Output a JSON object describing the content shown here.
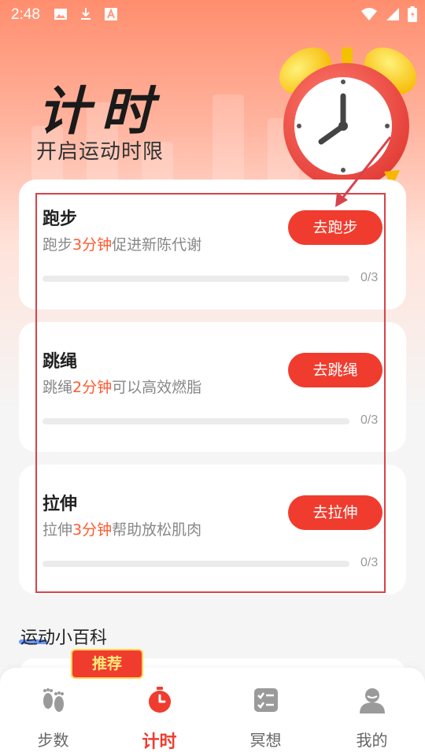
{
  "status_bar": {
    "time": "2:48",
    "left_icons": [
      "image-icon",
      "download-icon",
      "font-a-icon"
    ],
    "right_icons": [
      "wifi-icon",
      "signal-icon",
      "battery-icon"
    ]
  },
  "header": {
    "title": "计时",
    "subtitle": "开启运动时限"
  },
  "colors": {
    "accent": "#f03c2e",
    "highlight_text": "#ff5a2e",
    "annotation": "#d8434b"
  },
  "tasks": [
    {
      "title": "跑步",
      "desc_prefix": "跑步",
      "desc_highlight": "3分钟",
      "desc_suffix": "促进新陈代谢",
      "button": "去跑步",
      "progress": "0/3",
      "progress_fraction": 0
    },
    {
      "title": "跳绳",
      "desc_prefix": "跳绳",
      "desc_highlight": "2分钟",
      "desc_suffix": "可以高效燃脂",
      "button": "去跳绳",
      "progress": "0/3",
      "progress_fraction": 0
    },
    {
      "title": "拉伸",
      "desc_prefix": "拉伸",
      "desc_highlight": "3分钟",
      "desc_suffix": "帮助放松肌肉",
      "button": "去拉伸",
      "progress": "0/3",
      "progress_fraction": 0
    }
  ],
  "encyclopedia": {
    "title": "运动小百科",
    "badge": "推荐"
  },
  "tabbar": [
    {
      "label": "步数",
      "icon": "footprints-icon",
      "active": false
    },
    {
      "label": "计时",
      "icon": "stopwatch-icon",
      "active": true
    },
    {
      "label": "冥想",
      "icon": "checklist-icon",
      "active": false
    },
    {
      "label": "我的",
      "icon": "person-icon",
      "active": false
    }
  ]
}
